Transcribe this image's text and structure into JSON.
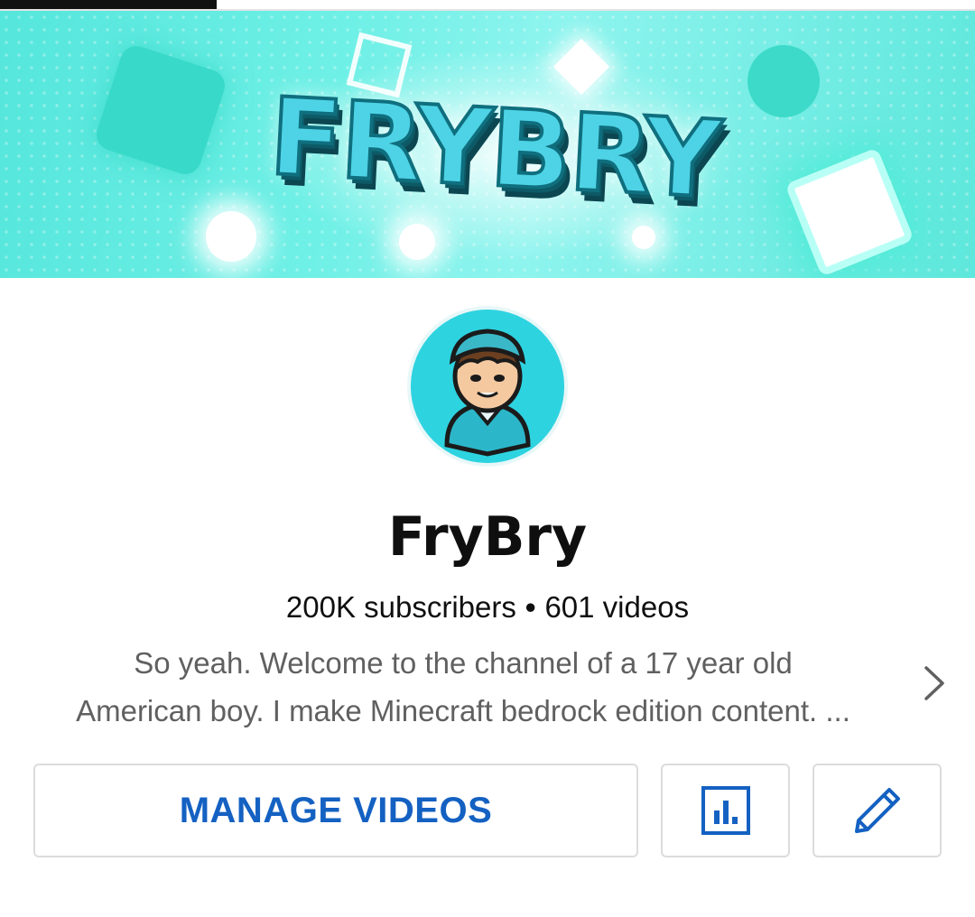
{
  "banner": {
    "logo_text": "FRYBRY",
    "accent_color": "#5ee7dc"
  },
  "channel": {
    "name": "FryBry",
    "subscribers": "200K subscribers",
    "separator": "•",
    "videos": "601 videos",
    "description_line1": "So yeah. Welcome to the channel of a 17 year old",
    "description_line2": "American boy. I make Minecraft bedrock edition content. ..."
  },
  "actions": {
    "manage_videos_label": "MANAGE VIDEOS",
    "stats_icon": "analytics-icon",
    "edit_icon": "pencil-icon",
    "accent_color": "#1461c2"
  },
  "icons": {
    "description_expand": "chevron-right-icon"
  }
}
